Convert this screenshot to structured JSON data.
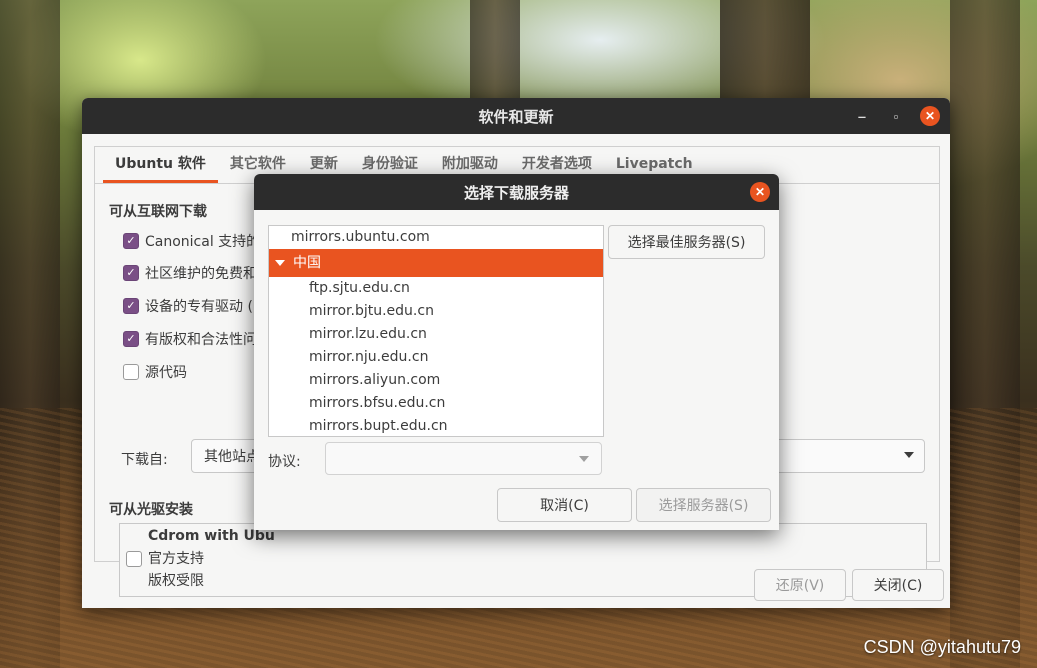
{
  "window": {
    "title": "软件和更新",
    "minimize_glyph": "‒",
    "maximize_glyph": "▫",
    "close_glyph": "✕"
  },
  "tabs": [
    {
      "label": "Ubuntu 软件",
      "active": true
    },
    {
      "label": "其它软件"
    },
    {
      "label": "更新"
    },
    {
      "label": "身份验证"
    },
    {
      "label": "附加驱动"
    },
    {
      "label": "开发者选项"
    },
    {
      "label": "Livepatch"
    }
  ],
  "internet_section": {
    "title": "可从互联网下载",
    "items": [
      {
        "label": "Canonical 支持的",
        "checked": true
      },
      {
        "label": "社区维护的免费和",
        "checked": true
      },
      {
        "label": "设备的专有驱动 (",
        "checked": true
      },
      {
        "label": "有版权和合法性问",
        "checked": true
      },
      {
        "label": "源代码",
        "checked": false
      }
    ],
    "download_from_label": "下载自:",
    "download_from_value": "其他站点"
  },
  "cdrom_section": {
    "title": "可从光驱安装",
    "name": "Cdrom with Ubu",
    "line1": "官方支持",
    "line2": "版权受限"
  },
  "bottom_buttons": {
    "revert": "还原(V)",
    "close": "关闭(C)"
  },
  "dialog": {
    "title": "选择下载服务器",
    "close_glyph": "✕",
    "servers_top": "mirrors.ubuntu.com",
    "group": "中国",
    "servers": [
      "ftp.sjtu.edu.cn",
      "mirror.bjtu.edu.cn",
      "mirror.lzu.edu.cn",
      "mirror.nju.edu.cn",
      "mirrors.aliyun.com",
      "mirrors.bfsu.edu.cn",
      "mirrors.bupt.edu.cn"
    ],
    "best_server_button": "选择最佳服务器(S)",
    "protocol_label": "协议:",
    "protocol_value": "",
    "cancel_button": "取消(C)",
    "choose_button": "选择服务器(S)"
  },
  "watermark": "CSDN @yitahutu79",
  "colors": {
    "accent": "#e95420",
    "checkbox": "#7a4f86",
    "titlebar": "#2c2c2c"
  }
}
